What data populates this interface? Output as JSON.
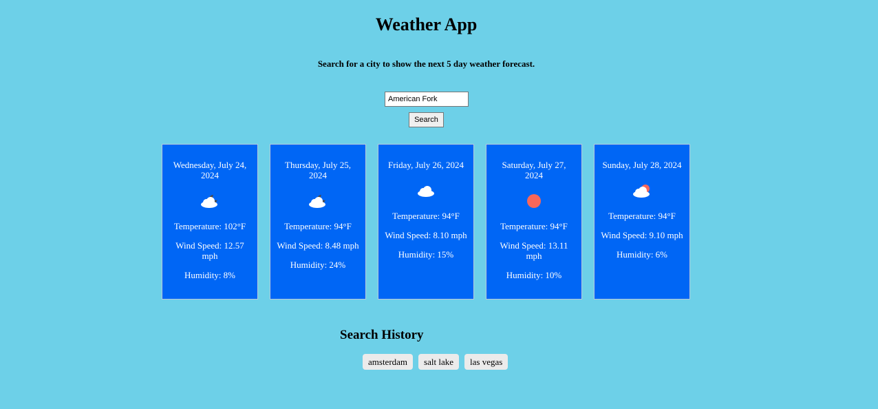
{
  "header": {
    "title": "Weather App",
    "subtitle": "Search for a city to show the next 5 day weather forecast."
  },
  "search": {
    "value": "American Fork",
    "button_label": "Search"
  },
  "forecast": [
    {
      "date": "Wednesday, July 24, 2024",
      "icon": "few-clouds-night-icon",
      "temperature": "Temperature: 102°F",
      "wind": "Wind Speed: 12.57 mph",
      "humidity": "Humidity: 8%"
    },
    {
      "date": "Thursday, July 25, 2024",
      "icon": "few-clouds-night-icon",
      "temperature": "Temperature: 94°F",
      "wind": "Wind Speed: 8.48 mph",
      "humidity": "Humidity: 24%"
    },
    {
      "date": "Friday, July 26, 2024",
      "icon": "cloud-icon",
      "temperature": "Temperature: 94°F",
      "wind": "Wind Speed: 8.10 mph",
      "humidity": "Humidity: 15%"
    },
    {
      "date": "Saturday, July 27, 2024",
      "icon": "sun-icon",
      "temperature": "Temperature: 94°F",
      "wind": "Wind Speed: 13.11 mph",
      "humidity": "Humidity: 10%"
    },
    {
      "date": "Sunday, July 28, 2024",
      "icon": "few-clouds-day-icon",
      "temperature": "Temperature: 94°F",
      "wind": "Wind Speed: 9.10 mph",
      "humidity": "Humidity: 6%"
    }
  ],
  "history": {
    "title": "Search History",
    "items": [
      "amsterdam",
      "salt lake",
      "las vegas"
    ]
  },
  "colors": {
    "background": "#6dd0e8",
    "card": "#0066f5",
    "sun": "#f8675a",
    "cloud": "#ffffff",
    "moon": "#4a4a4a"
  }
}
